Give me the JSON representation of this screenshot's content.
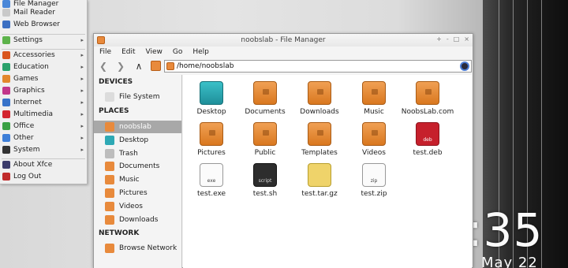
{
  "app_menu": {
    "items": [
      {
        "label": "File Manager",
        "color": "#4a87d8",
        "icon": "file-manager-icon",
        "submenu": false
      },
      {
        "label": "Mail Reader",
        "color": "#c9c9c9",
        "icon": "mail-icon",
        "submenu": false
      },
      {
        "label": "Web Browser",
        "color": "#3b6fc2",
        "icon": "browser-icon",
        "submenu": false
      },
      {
        "label": "Settings",
        "color": "#5db34b",
        "icon": "settings-icon",
        "submenu": true
      },
      {
        "label": "Accessories",
        "color": "#d9561e",
        "icon": "accessories-icon",
        "submenu": true
      },
      {
        "label": "Education",
        "color": "#2aa26b",
        "icon": "education-icon",
        "submenu": true
      },
      {
        "label": "Games",
        "color": "#e2872c",
        "icon": "games-icon",
        "submenu": true
      },
      {
        "label": "Graphics",
        "color": "#c2368a",
        "icon": "graphics-icon",
        "submenu": true
      },
      {
        "label": "Internet",
        "color": "#3672c9",
        "icon": "internet-icon",
        "submenu": true
      },
      {
        "label": "Multimedia",
        "color": "#d3242e",
        "icon": "multimedia-icon",
        "submenu": true
      },
      {
        "label": "Office",
        "color": "#3aa043",
        "icon": "office-icon",
        "submenu": true
      },
      {
        "label": "Other",
        "color": "#3e7fd8",
        "icon": "other-icon",
        "submenu": true
      },
      {
        "label": "System",
        "color": "#333333",
        "icon": "system-icon",
        "submenu": true
      },
      {
        "label": "About Xfce",
        "color": "#3b3b6b",
        "icon": "about-icon",
        "submenu": false
      },
      {
        "label": "Log Out",
        "color": "#c02a2a",
        "icon": "logout-icon",
        "submenu": false
      }
    ]
  },
  "window": {
    "title": "noobslab - File Manager",
    "buttons": [
      "+",
      "-",
      "□",
      "×"
    ],
    "menu": [
      "File",
      "Edit",
      "View",
      "Go",
      "Help"
    ],
    "nav": {
      "back": "❮",
      "forward": "❯",
      "up": "∧"
    },
    "location": "/home/noobslab"
  },
  "sidebar": {
    "devices_heading": "DEVICES",
    "devices": [
      {
        "label": "File System",
        "color": "#dcdcdc"
      }
    ],
    "places_heading": "PLACES",
    "places": [
      {
        "label": "noobslab",
        "color": "#e88a3c",
        "selected": true
      },
      {
        "label": "Desktop",
        "color": "#2ea9b5",
        "selected": false
      },
      {
        "label": "Trash",
        "color": "#bdbdbd",
        "selected": false
      },
      {
        "label": "Documents",
        "color": "#e88a3c",
        "selected": false
      },
      {
        "label": "Music",
        "color": "#e88a3c",
        "selected": false
      },
      {
        "label": "Pictures",
        "color": "#e88a3c",
        "selected": false
      },
      {
        "label": "Videos",
        "color": "#e88a3c",
        "selected": false
      },
      {
        "label": "Downloads",
        "color": "#e88a3c",
        "selected": false
      }
    ],
    "network_heading": "NETWORK",
    "network": [
      {
        "label": "Browse Network",
        "color": "#e88a3c"
      }
    ]
  },
  "files": [
    {
      "label": "Desktop",
      "kind": "desk-ico",
      "tag": ""
    },
    {
      "label": "Documents",
      "kind": "folder",
      "tag": ""
    },
    {
      "label": "Downloads",
      "kind": "folder",
      "tag": ""
    },
    {
      "label": "Music",
      "kind": "folder",
      "tag": ""
    },
    {
      "label": "NoobsLab.com",
      "kind": "folder",
      "tag": ""
    },
    {
      "label": "Pictures",
      "kind": "folder",
      "tag": ""
    },
    {
      "label": "Public",
      "kind": "folder",
      "tag": ""
    },
    {
      "label": "Templates",
      "kind": "folder",
      "tag": ""
    },
    {
      "label": "Videos",
      "kind": "folder",
      "tag": ""
    },
    {
      "label": "test.deb",
      "kind": "deb-ico",
      "tag": "deb"
    },
    {
      "label": "test.exe",
      "kind": "doc-ico",
      "tag": "exe"
    },
    {
      "label": "test.sh",
      "kind": "sh-ico",
      "tag": "script"
    },
    {
      "label": "test.tar.gz",
      "kind": "tgz-ico",
      "tag": ""
    },
    {
      "label": "test.zip",
      "kind": "zip-ico",
      "tag": "zip"
    }
  ],
  "desktop": {
    "clock": ":35",
    "date": "May 22"
  }
}
